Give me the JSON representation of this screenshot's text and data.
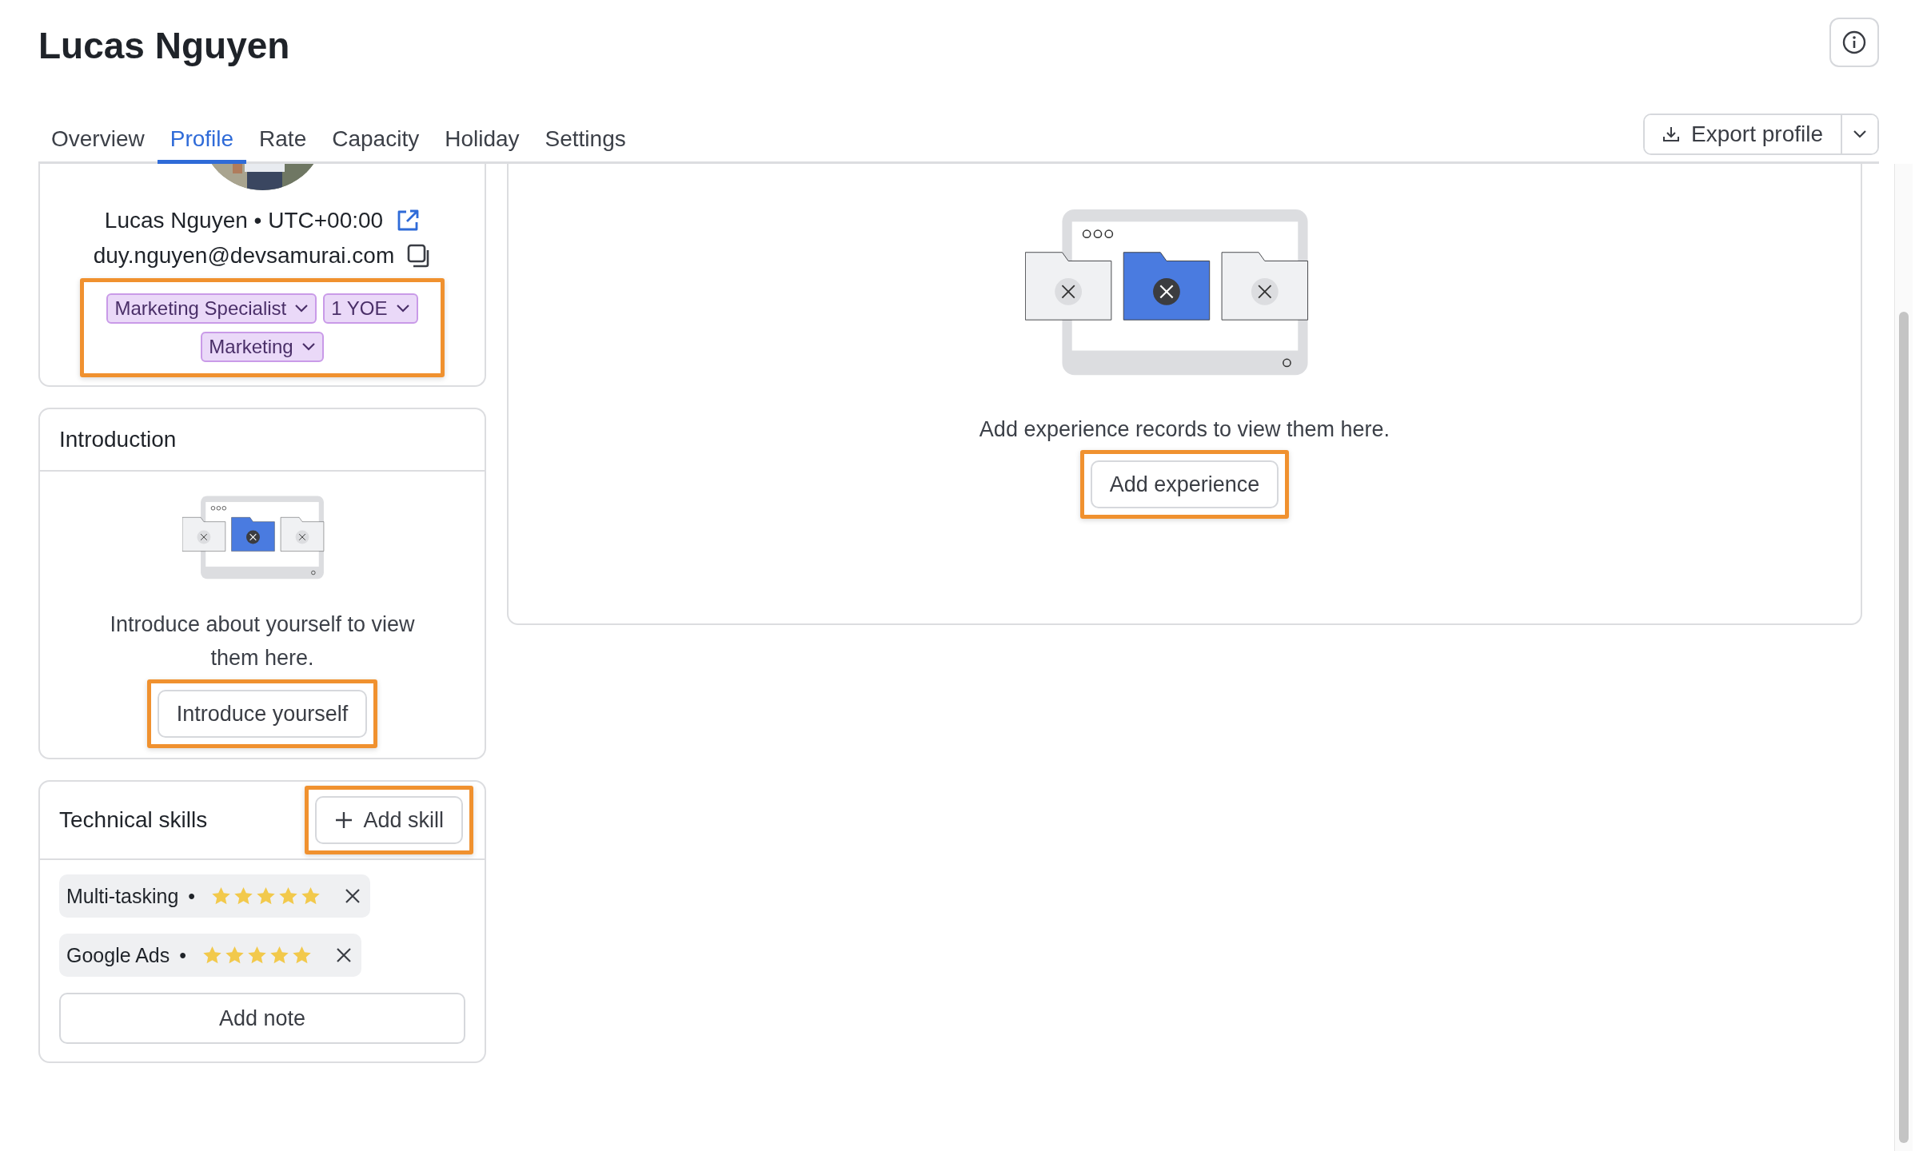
{
  "page_title": "Lucas Nguyen",
  "tabs": [
    {
      "label": "Overview",
      "selected": false
    },
    {
      "label": "Profile",
      "selected": true
    },
    {
      "label": "Rate",
      "selected": false
    },
    {
      "label": "Capacity",
      "selected": false
    },
    {
      "label": "Holiday",
      "selected": false
    },
    {
      "label": "Settings",
      "selected": false
    }
  ],
  "export_button": {
    "label": "Export profile"
  },
  "profile": {
    "name_line": "Lucas Nguyen • UTC+00:00",
    "email": "duy.nguyen@devsamurai.com",
    "tags_highlighted": true,
    "tags": [
      {
        "label": "Marketing Specialist"
      },
      {
        "label": "1 YOE"
      },
      {
        "label": "Marketing"
      }
    ]
  },
  "introduction": {
    "title": "Introduction",
    "message": "Introduce about yourself to view them here.",
    "button": {
      "label": "Introduce yourself",
      "highlighted": true
    }
  },
  "skills": {
    "title": "Technical skills",
    "add_button": {
      "label": "Add skill",
      "highlighted": true
    },
    "items": [
      {
        "name": "Multi-tasking",
        "separator": "•",
        "stars": 5
      },
      {
        "name": "Google Ads",
        "separator": "•",
        "stars": 5
      }
    ],
    "note_button": {
      "label": "Add note"
    }
  },
  "experience": {
    "message": "Add experience records to view them here.",
    "button": {
      "label": "Add experience",
      "highlighted": true
    }
  }
}
